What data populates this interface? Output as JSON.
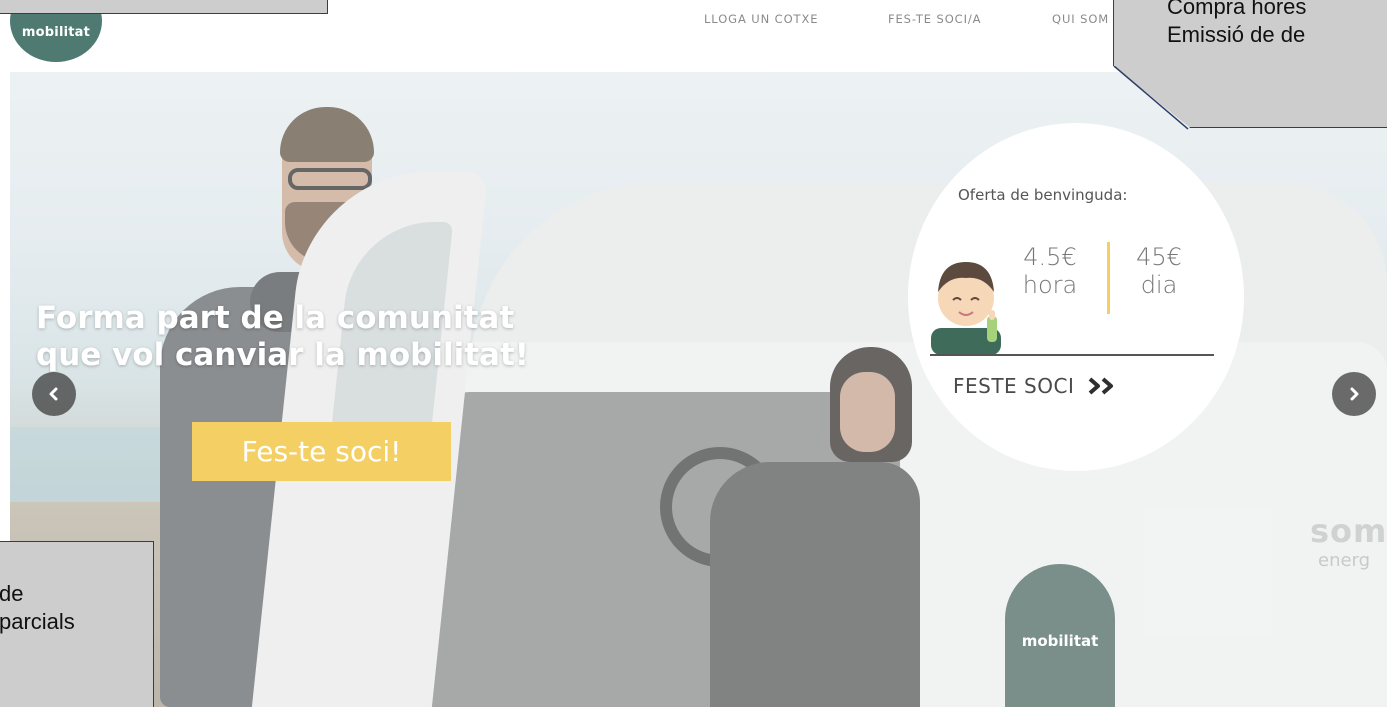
{
  "header": {
    "logo_text": "mobilitat",
    "nav": [
      {
        "label": "LLOGA UN COTXE"
      },
      {
        "label": "FES-TE SOCI/A"
      },
      {
        "label": "QUI SOM"
      }
    ]
  },
  "hero": {
    "headline_line1": "Forma part de la comunitat",
    "headline_line2": "que vol canviar la mobilitat!",
    "cta_label": "Fes-te soci!",
    "prev_icon": "chevron-left-icon",
    "next_icon": "chevron-right-icon",
    "car_logo_text": "mobilitat",
    "car_brand_text": "som",
    "car_brand_sub": "energ"
  },
  "offer": {
    "title": "Oferta de benvinguda:",
    "hour_price": "4.5€",
    "hour_unit": "hora",
    "day_price": "45€",
    "day_unit": "dia",
    "link_label": "FESTE SOCI",
    "link_icon": "double-chevron-right-icon"
  },
  "callouts": {
    "top_right_line1": "Compra hores",
    "top_right_line2": "Emissió de de",
    "bottom_left_line1": "de",
    "bottom_left_line2": "parcials"
  },
  "colors": {
    "logo_green": "#4f7a72",
    "cta_yellow": "#f4cf63",
    "nav_gray": "#8a8a8a",
    "callout_border": "#2c3e66",
    "callout_fill": "#cdcdcd"
  }
}
